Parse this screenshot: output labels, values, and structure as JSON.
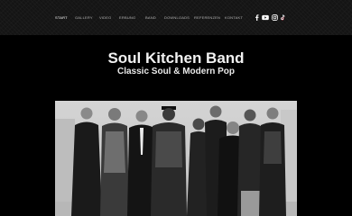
{
  "nav": {
    "items": [
      {
        "label": "Start",
        "active": true
      },
      {
        "label": "Gallery",
        "active": false
      },
      {
        "label": "Video",
        "active": false
      },
      {
        "label": "Erbung",
        "active": false
      },
      {
        "label": "Band",
        "active": false
      },
      {
        "label": "Downloads",
        "active": false
      },
      {
        "label": "Referenzen",
        "active": false
      },
      {
        "label": "Kontakt",
        "active": false
      }
    ]
  },
  "social": {
    "icons": [
      "facebook-icon",
      "youtube-icon",
      "instagram-icon",
      "tiktok-icon"
    ]
  },
  "hero": {
    "title": "Soul Kitchen Band",
    "subtitle": "Classic Soul & Modern Pop"
  },
  "colors": {
    "background": "#000000",
    "header": "#141414",
    "nav_text": "#b5b5b5",
    "nav_active": "#ffffff"
  }
}
